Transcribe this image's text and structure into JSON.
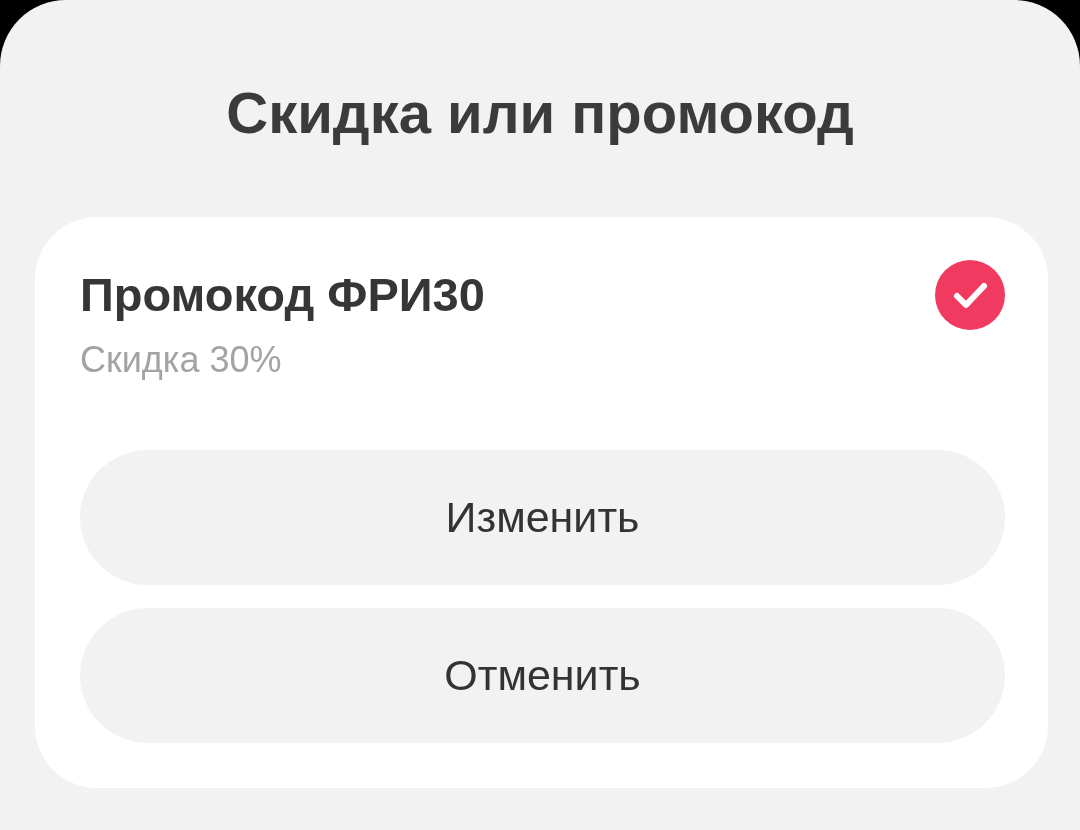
{
  "sheet": {
    "title": "Скидка или промокод"
  },
  "promo": {
    "title": "Промокод ФРИ30",
    "subtitle": "Скидка 30%",
    "selected": true
  },
  "buttons": [
    {
      "label": "Изменить"
    },
    {
      "label": "Отменить"
    }
  ]
}
